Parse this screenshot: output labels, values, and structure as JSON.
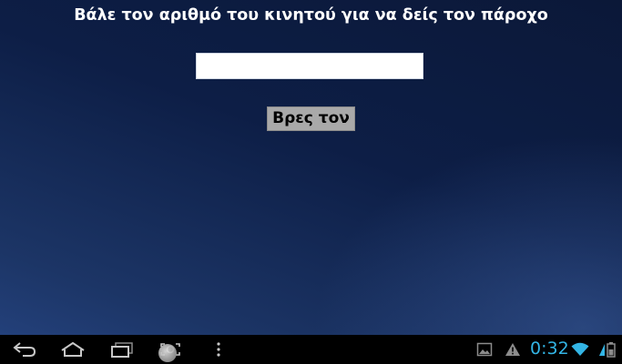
{
  "app": {
    "title": "Βάλε τον αριθμό του κινητού για να δείς τον πάροχο",
    "phone_input": {
      "value": "",
      "placeholder": ""
    },
    "find_button_label": "Βρες τον"
  },
  "navbar": {
    "icons": [
      "back-icon",
      "home-icon",
      "recent-apps-icon",
      "screenshot-icon",
      "menu-icon"
    ]
  },
  "status_bar": {
    "icons": [
      "gallery-notification-icon",
      "warning-icon",
      "wifi-icon",
      "battery-icon"
    ],
    "time": "0:32",
    "accent_color": "#33b5e5"
  }
}
